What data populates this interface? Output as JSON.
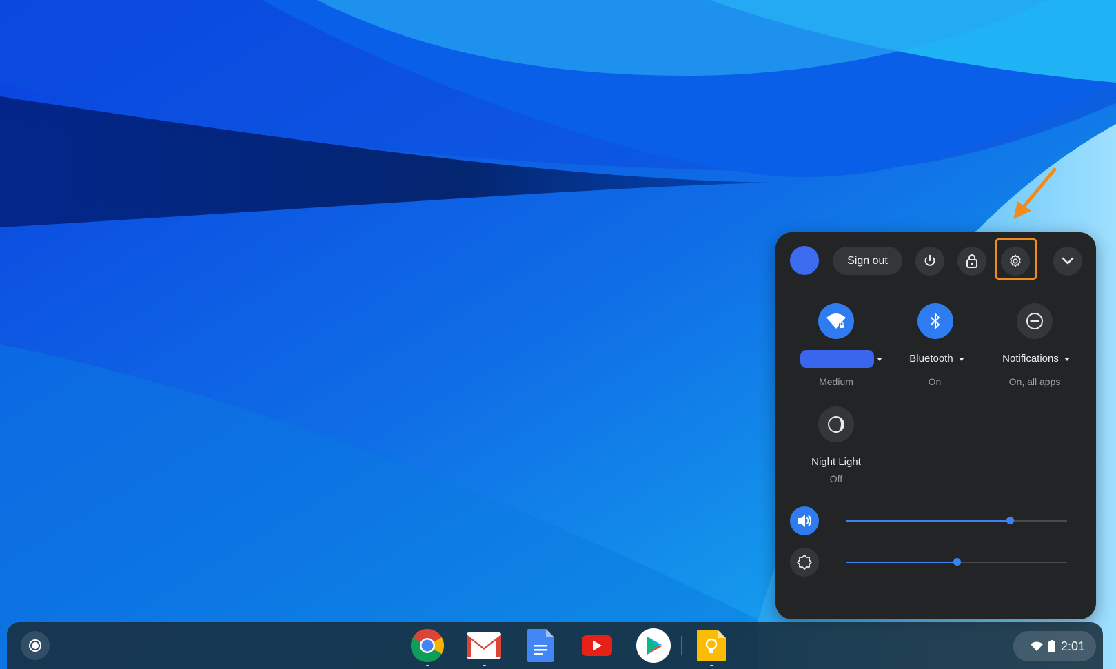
{
  "quick_settings": {
    "sign_out_label": "Sign out",
    "network": {
      "name": "",
      "status": "Medium"
    },
    "bluetooth": {
      "label": "Bluetooth",
      "status": "On"
    },
    "notifications": {
      "label": "Notifications",
      "status": "On, all apps"
    },
    "night_light": {
      "label": "Night Light",
      "status": "Off"
    },
    "volume": {
      "level": 0.74
    },
    "brightness": {
      "level": 0.5
    }
  },
  "shelf": {
    "apps": [
      "chrome-icon",
      "gmail-icon",
      "docs-icon",
      "youtube-icon",
      "play-store-icon",
      "keep-icon"
    ],
    "tray": {
      "time": "2:01"
    }
  },
  "colors": {
    "panel_bg": "#232426",
    "accent": "#2f7cf0",
    "highlight": "#f28b1d"
  }
}
